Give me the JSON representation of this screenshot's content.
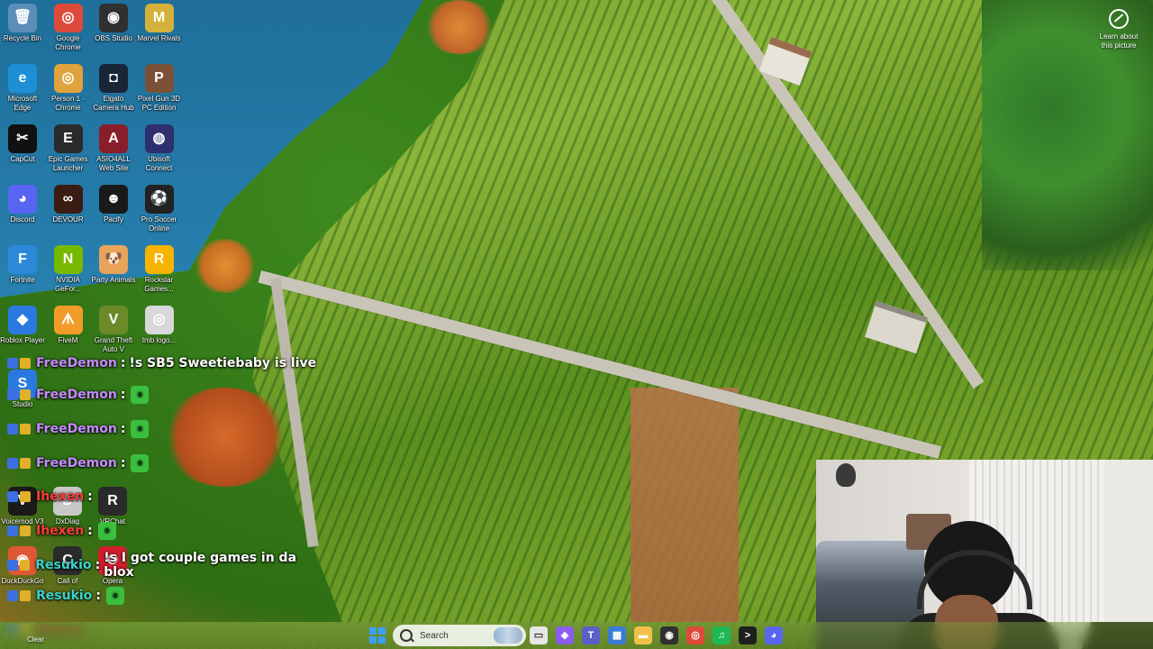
{
  "desktop": {
    "icons": [
      {
        "label": "Recycle Bin",
        "glyph": "🗑",
        "color": "#5b8fb9"
      },
      {
        "label": "Google Chrome",
        "glyph": "◎",
        "color": "#de4a3a"
      },
      {
        "label": "OBS Studio",
        "glyph": "◉",
        "color": "#303030"
      },
      {
        "label": "Marvel Rivals",
        "glyph": "M",
        "color": "#d5b13c"
      },
      {
        "label": "Microsoft Edge",
        "glyph": "e",
        "color": "#1d8fd4"
      },
      {
        "label": "Person 1 - Chrome",
        "glyph": "◎",
        "color": "#e0a23c"
      },
      {
        "label": "Elgato Camera Hub",
        "glyph": "◘",
        "color": "#1a2538"
      },
      {
        "label": "Pixel Gun 3D PC Edition",
        "glyph": "P",
        "color": "#7a5136"
      },
      {
        "label": "CapCut",
        "glyph": "✂",
        "color": "#111111"
      },
      {
        "label": "Epic Games Launcher",
        "glyph": "E",
        "color": "#2a2a2a"
      },
      {
        "label": "ASIO4ALL Web Site",
        "glyph": "A",
        "color": "#8a1d2a"
      },
      {
        "label": "Ubisoft Connect",
        "glyph": "◍",
        "color": "#2d2f6e"
      },
      {
        "label": "Discord",
        "glyph": "◕",
        "color": "#5865f2"
      },
      {
        "label": "DEVOUR",
        "glyph": "∞",
        "color": "#3a1c12"
      },
      {
        "label": "Pacify",
        "glyph": "☻",
        "color": "#1a1a1a"
      },
      {
        "label": "Pro Soccer Online",
        "glyph": "⚽",
        "color": "#222222"
      },
      {
        "label": "Fortnite",
        "glyph": "F",
        "color": "#2c88d9"
      },
      {
        "label": "NVIDIA GeFor...",
        "glyph": "N",
        "color": "#76b900"
      },
      {
        "label": "Party Animals",
        "glyph": "🐶",
        "color": "#e8a45b"
      },
      {
        "label": "Rockstar Games...",
        "glyph": "R",
        "color": "#f6b400"
      },
      {
        "label": "Roblox Player",
        "glyph": "◆",
        "color": "#2a79e0"
      },
      {
        "label": "FiveM",
        "glyph": "ᗑ",
        "color": "#f39b2a"
      },
      {
        "label": "Grand Theft Auto V",
        "glyph": "V",
        "color": "#6c8a2a"
      },
      {
        "label": "tmb logo...",
        "glyph": "◎",
        "color": "#d8d8d8"
      }
    ],
    "bottom_icons": [
      {
        "label": "Studio",
        "glyph": "S",
        "color": "#2a79e0"
      },
      {
        "label": "Voicemod V3",
        "glyph": "V",
        "color": "#1a1a1a"
      },
      {
        "label": "DxDiag",
        "glyph": "D",
        "color": "#c8c8c8"
      },
      {
        "label": "VRChat",
        "glyph": "R",
        "color": "#2a2a2a"
      },
      {
        "label": "DuckDuckGo",
        "glyph": "◉",
        "color": "#de5833"
      },
      {
        "label": "Call of",
        "glyph": "C",
        "color": "#2b2b2b"
      },
      {
        "label": "Opera",
        "glyph": "O",
        "color": "#d11e2f"
      }
    ]
  },
  "chat": {
    "lines": [
      {
        "user": "FreeDemon",
        "user_color": "#c58bff",
        "sep": ":",
        "message": "!s SB5 Sweetiebaby is live",
        "emote": ""
      },
      {
        "user": "FreeDemon",
        "user_color": "#c58bff",
        "sep": ":",
        "message": "",
        "emote": "•"
      },
      {
        "user": "FreeDemon",
        "user_color": "#c58bff",
        "sep": ":",
        "message": "",
        "emote": "•"
      },
      {
        "user": "FreeDemon",
        "user_color": "#c58bff",
        "sep": ":",
        "message": "",
        "emote": "•"
      },
      {
        "user": "Ihexen",
        "user_color": "#ff3b3b",
        "sep": ":",
        "message": "",
        "emote": ""
      },
      {
        "user": "Ihexen",
        "user_color": "#ff3b3b",
        "sep": ":",
        "message": "",
        "emote": "•"
      },
      {
        "user": "Resukio",
        "user_color": "#3bd3c8",
        "sep": ":",
        "message": "!s I got couple games in da blox",
        "emote": ""
      },
      {
        "user": "Resukio",
        "user_color": "#3bd3c8",
        "sep": ":",
        "message": "",
        "emote": "•"
      },
      {
        "user": "Ihexen",
        "user_color": "#ff3b3b",
        "sep": ":",
        "message": "",
        "emote": ""
      }
    ]
  },
  "overlay": {
    "learn_line1": "Learn about",
    "learn_line2": "this picture"
  },
  "taskbar": {
    "search_placeholder": "Search",
    "clear_label": "Clear",
    "apps": [
      {
        "name": "task-view",
        "glyph": "▭",
        "color": "#e6e6e6"
      },
      {
        "name": "copilot",
        "glyph": "◈",
        "color": "#8a5cf0"
      },
      {
        "name": "teams",
        "glyph": "T",
        "color": "#5b5fc7"
      },
      {
        "name": "store",
        "glyph": "▦",
        "color": "#3a7bd5"
      },
      {
        "name": "file-explorer",
        "glyph": "▬",
        "color": "#f2c04a"
      },
      {
        "name": "obs",
        "glyph": "◉",
        "color": "#303030"
      },
      {
        "name": "chrome",
        "glyph": "◎",
        "color": "#de4a3a"
      },
      {
        "name": "spotify",
        "glyph": "♫",
        "color": "#1db954"
      },
      {
        "name": "terminal",
        "glyph": ">",
        "color": "#1f1f1f"
      },
      {
        "name": "discord",
        "glyph": "◕",
        "color": "#5865f2"
      }
    ]
  }
}
